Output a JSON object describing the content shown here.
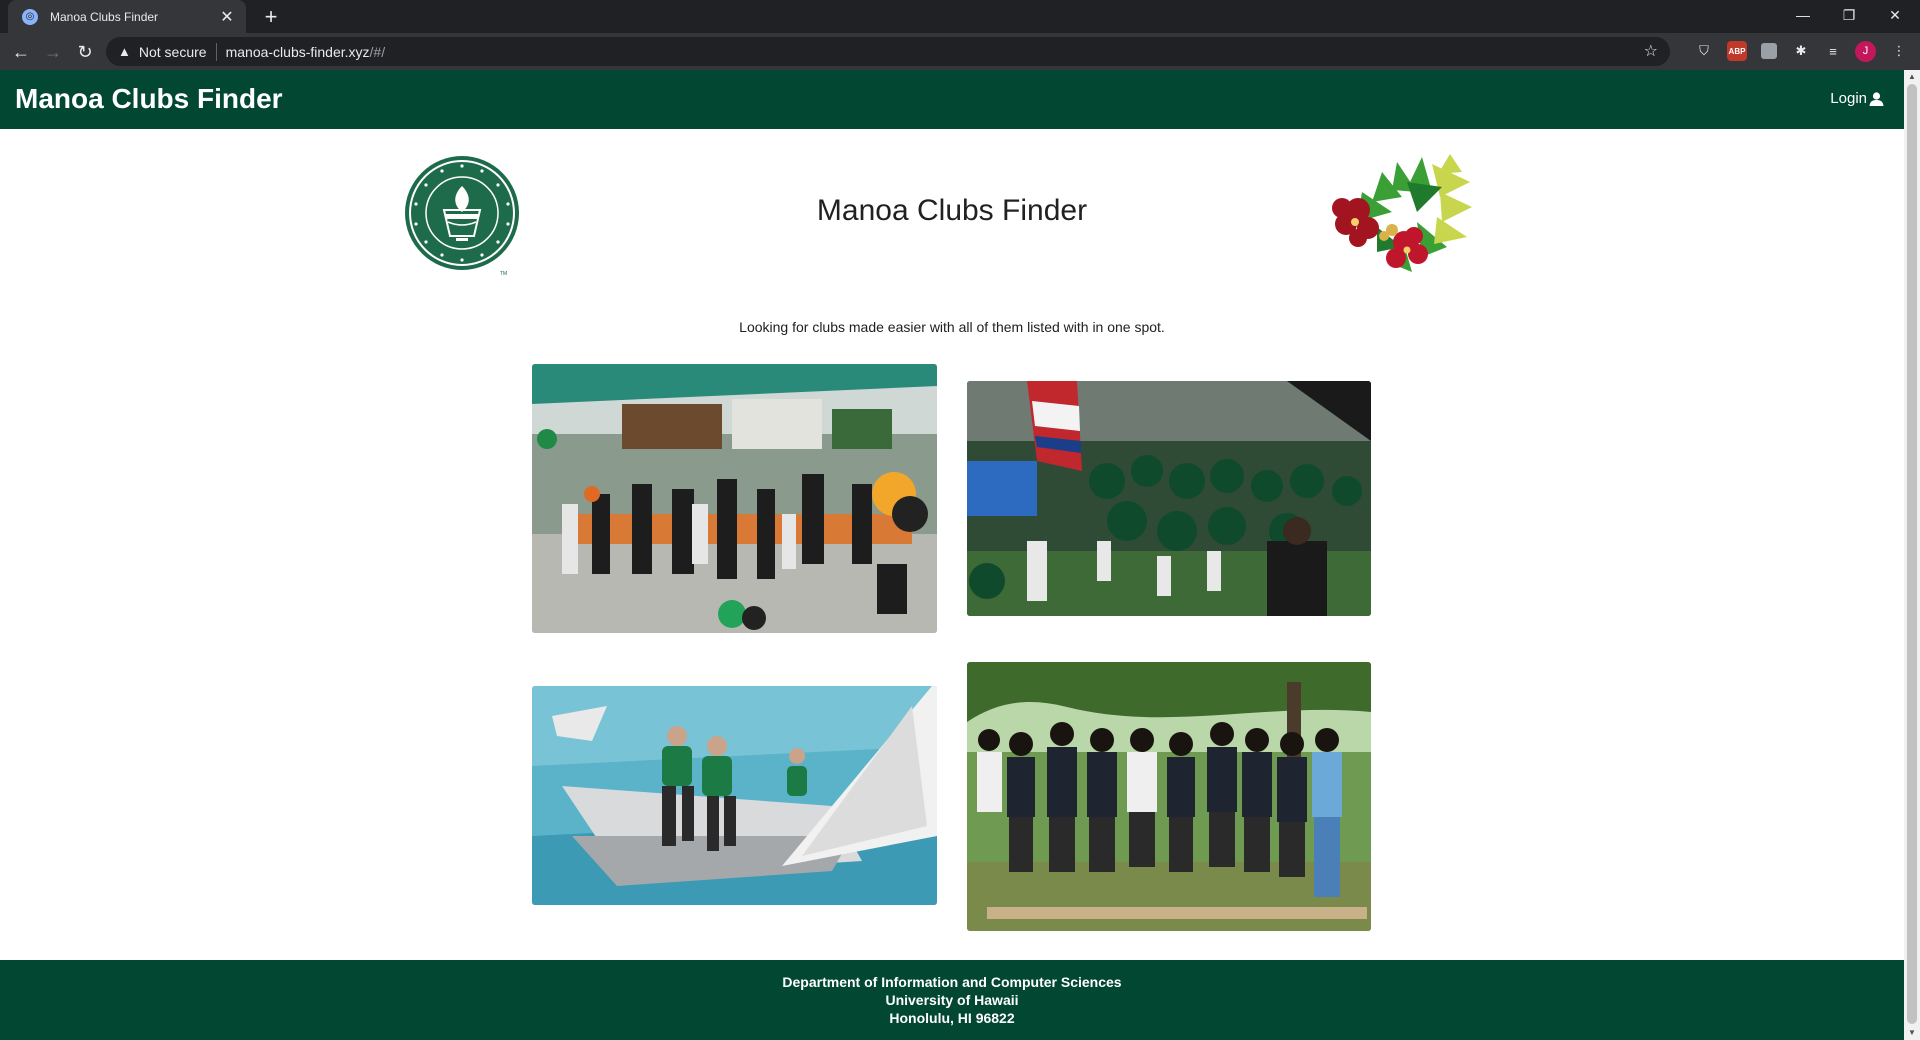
{
  "browser": {
    "tab_title": "Manoa Clubs Finder",
    "security_label": "Not secure",
    "url_host": "manoa-clubs-finder.xyz",
    "url_path": "/#/",
    "avatar_initial": "J",
    "abp_label": "ABP"
  },
  "header": {
    "brand": "Manoa Clubs Finder",
    "login_label": "Login"
  },
  "landing": {
    "title": "Manoa Clubs Finder",
    "tagline": "Looking for clubs made easier with all of them listed with in one spot."
  },
  "photos": [
    {
      "subject": "club fair with tents and students"
    },
    {
      "subject": "football team running onto field"
    },
    {
      "subject": "sailing team on a sailboat"
    },
    {
      "subject": "students walking together on planks"
    }
  ],
  "footer": {
    "line1": "Department of Information and Computer Sciences",
    "line2": "University of Hawaii",
    "line3": "Honolulu, HI 96822"
  },
  "colors": {
    "brand_green": "#024731",
    "chrome_dark": "#202124",
    "chrome_toolbar": "#35363a"
  }
}
